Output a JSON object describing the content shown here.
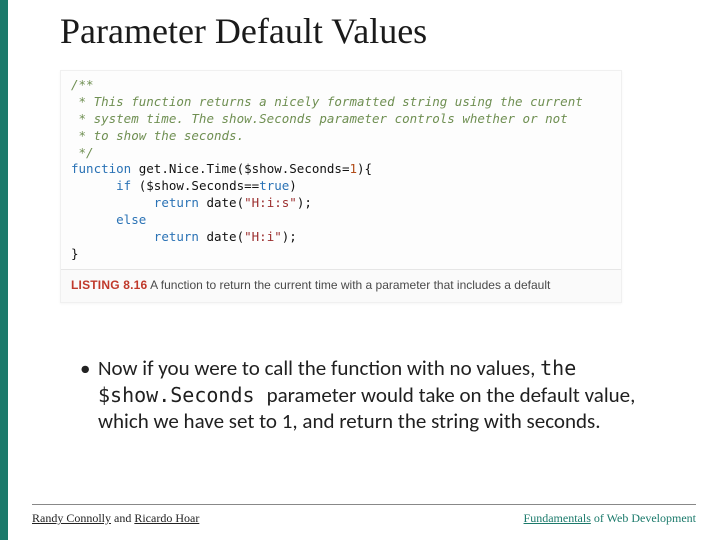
{
  "accent_color": "#1b7a6b",
  "title": "Parameter Default Values",
  "code": {
    "c1": "/**",
    "c2": " * This function returns a nicely formatted string using the current",
    "c3": " * system time. The show.Seconds parameter controls whether or not",
    "c4": " * to show the seconds.",
    "c5": " */",
    "kw_function": "function",
    "fn_name": "get.Nice.Time",
    "param_var": "$show.Seconds",
    "eq": "=",
    "default_val": "1",
    "brace_open": "){",
    "kw_if": "if",
    "cond_var": "$show.Seconds",
    "cond_op": "==",
    "kw_true": "true",
    "paren_close": ")",
    "kw_return1": "return",
    "date1_fn": "date(",
    "date1_str": "\"H:i:s\"",
    "date1_end": ");",
    "kw_else": "else",
    "kw_return2": "return",
    "date2_fn": "date(",
    "date2_str": "\"H:i\"",
    "date2_end": ");",
    "brace_close": "}"
  },
  "caption": {
    "label": "LISTING 8.16",
    "text": " A function to return the current time with a parameter that includes a default"
  },
  "bullet": {
    "pre": "Now if you were to call the function with no values, ",
    "code": "the $show.Seconds ",
    "post": "parameter would take on the default value, which we have set to 1, and return the string with seconds."
  },
  "footer": {
    "left_a": "Randy Connolly",
    "left_mid": " and ",
    "left_b": "Ricardo Hoar",
    "right_a": "Fundamentals",
    "right_b": " of Web Development"
  }
}
